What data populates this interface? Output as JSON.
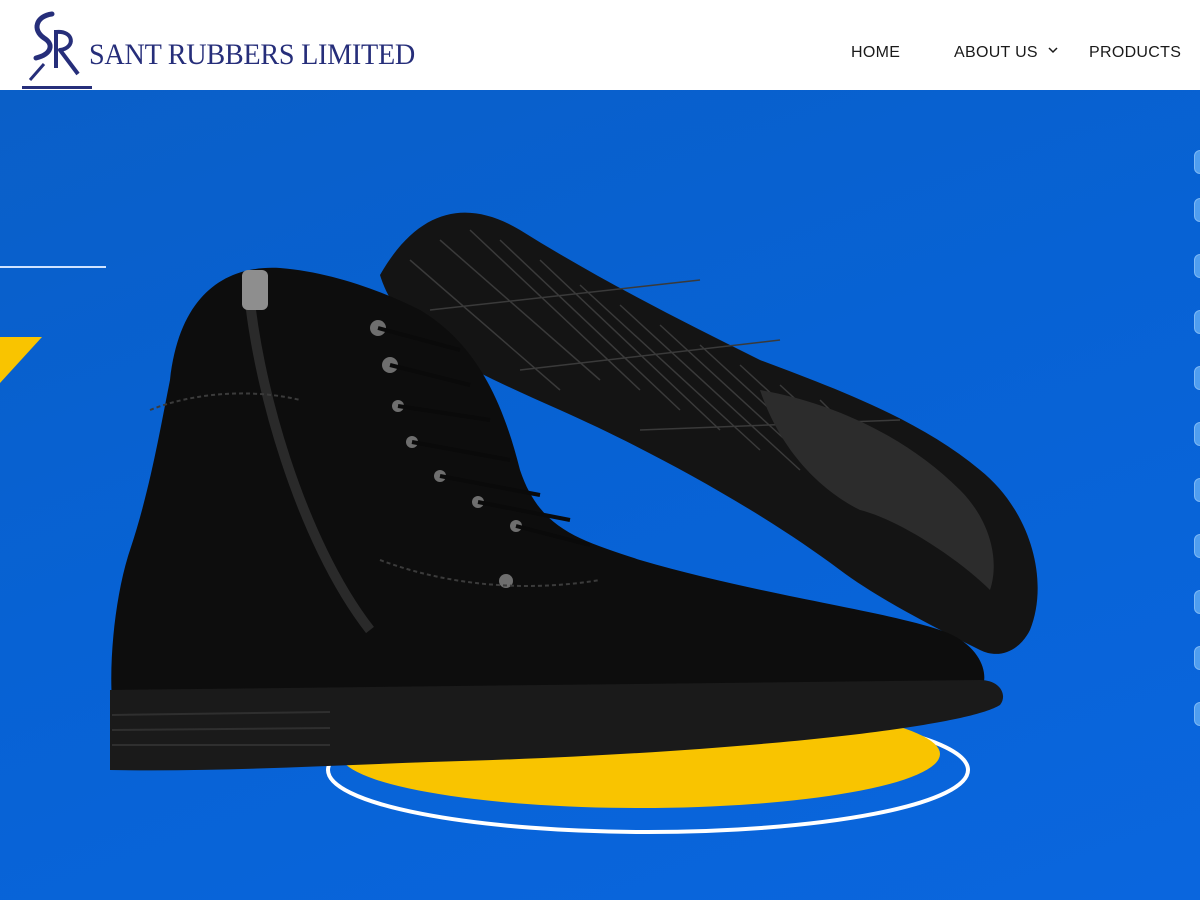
{
  "brand": {
    "name": "SANT RUBBERS LIMITED",
    "logo_monogram": "SR",
    "color_navy": "#262e7a"
  },
  "nav": {
    "items": [
      {
        "label": "HOME"
      },
      {
        "label": "ABOUT US",
        "has_dropdown": true
      },
      {
        "label": "PRODUCTS"
      }
    ]
  },
  "hero": {
    "background_color": "#0762d4",
    "accent_color": "#f9c400",
    "image_subject": "black leather zip-up lace-up boot with sole shown",
    "slides_indicator": "vertical slider dots on right edge"
  }
}
